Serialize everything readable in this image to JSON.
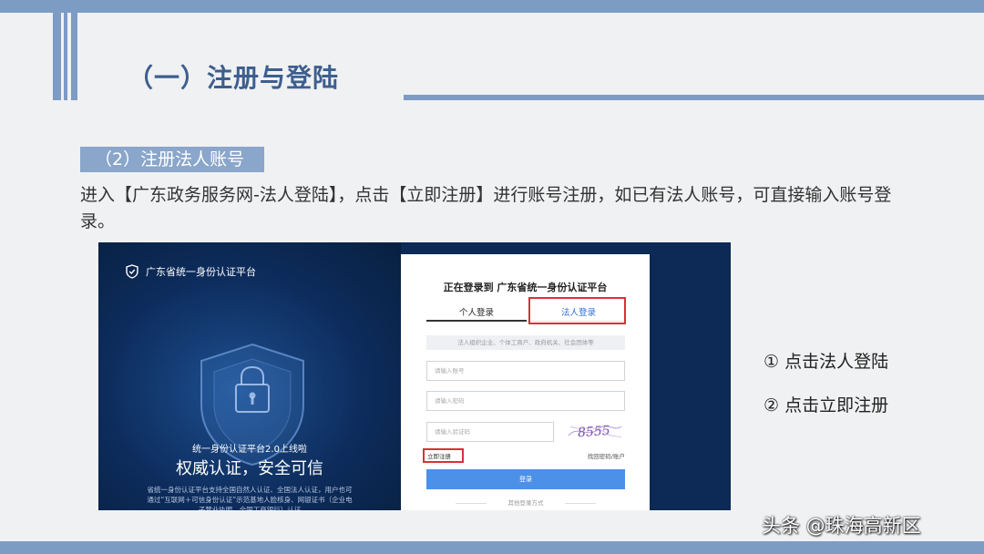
{
  "slide": {
    "title": "（一）注册与登陆",
    "subheading": "（2）注册法人账号",
    "paragraph": "进入【广东政务服务网-法人登陆】，点击【立即注册】进行账号注册，如已有法人账号，可直接输入账号登录。",
    "steps": [
      "① 点击法人登陆",
      "② 点击立即注册"
    ],
    "watermark": "头条 @珠海高新区"
  },
  "screenshot": {
    "platform_name": "广东省统一身份认证平台",
    "promo_line1": "统一身份认证平台2.0上线啦",
    "promo_line2": "权威认证，安全可信",
    "promo_desc": "省统一身份认证平台支持全国自然人认证、全国法人认证，用户也可通过“互联网＋可信身份认证”示范基地人脸核身、网银证书（企业电子营业执照、全国工商银行）认证",
    "login": {
      "title": "正在登录到 广东省统一身份认证平台",
      "tab_personal": "个人登录",
      "tab_legal": "法人登录",
      "note": "法人组织企业、个体工商户、政府机关、社会团体等",
      "account_placeholder": "请输入账号",
      "password_placeholder": "请输入密码",
      "captcha_placeholder": "请输入验证码",
      "captcha_text": "8555",
      "register_link": "立即注册",
      "forgot_link": "找回密码/账户",
      "login_button": "登录",
      "other_methods": "其他登录方式"
    }
  },
  "colors": {
    "accent_bar": "#7c9cc3",
    "title_text": "#3d5f8e",
    "subhead_bg": "#8aa6ca",
    "highlight_red": "#d9303a",
    "login_button": "#4d90e8",
    "screenshot_bg": "#0c2a55"
  }
}
